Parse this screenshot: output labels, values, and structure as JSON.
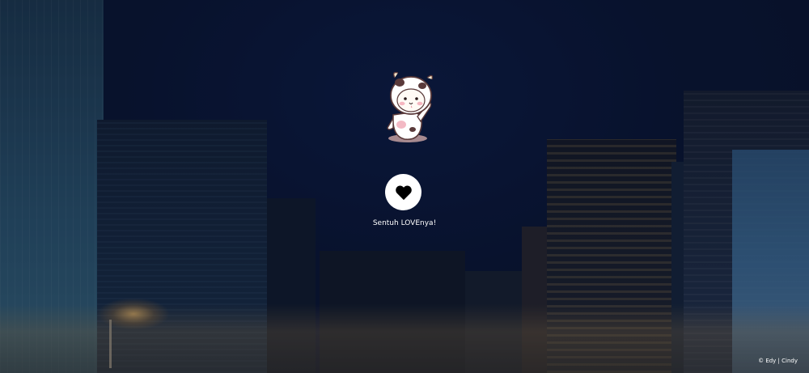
{
  "main": {
    "sticker_icon": "cow-costume-bear-sticker-icon",
    "heart_icon": "heart-icon",
    "heart_button_color": "#ffffff",
    "heart_color": "#000000",
    "caption": "Sentuh LOVEnya!"
  },
  "footer": {
    "credit": "© Edy | Cindy"
  },
  "background": {
    "description_icon": "night-city-background"
  }
}
